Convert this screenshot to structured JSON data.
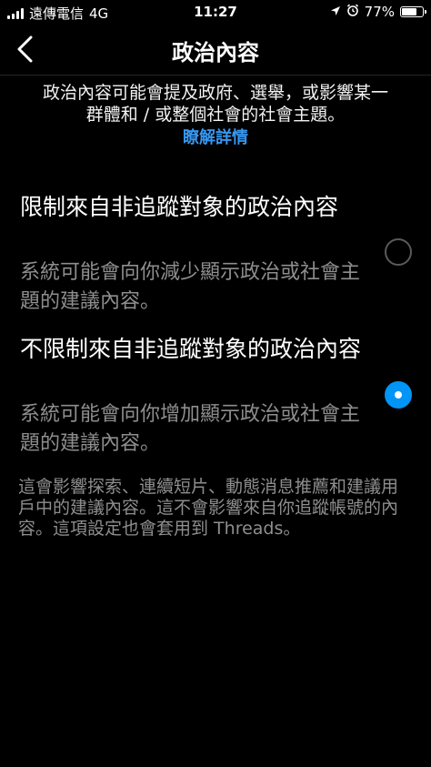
{
  "status_bar": {
    "carrier": "遠傳電信",
    "network": "4G",
    "time": "11:27",
    "battery_percent": "77%",
    "battery_level": 0.77
  },
  "nav": {
    "title": "政治內容",
    "back_icon": "chevron-left-icon"
  },
  "intro": {
    "text": "政治內容可能會提及政府、選舉，或影響某一群體和 / 或整個社會的社會主題。",
    "learn_more": "瞭解詳情",
    "link_color": "#3797f0"
  },
  "options": [
    {
      "title": "限制來自非追蹤對象的政治內容",
      "description": "系統可能會向你減少顯示政治或社會主題的建議內容。",
      "selected": false
    },
    {
      "title": "不限制來自非追蹤對象的政治內容",
      "description": "系統可能會向你增加顯示政治或社會主題的建議內容。",
      "selected": true
    }
  ],
  "footer": {
    "note": "這會影響探索、連續短片、動態消息推薦和建議用戶中的建議內容。這不會影響來自你追蹤帳號的內容。這項設定也會套用到 Threads。"
  },
  "colors": {
    "background": "#000000",
    "accent": "#0095f6",
    "secondary_text": "#8e8e8e"
  }
}
